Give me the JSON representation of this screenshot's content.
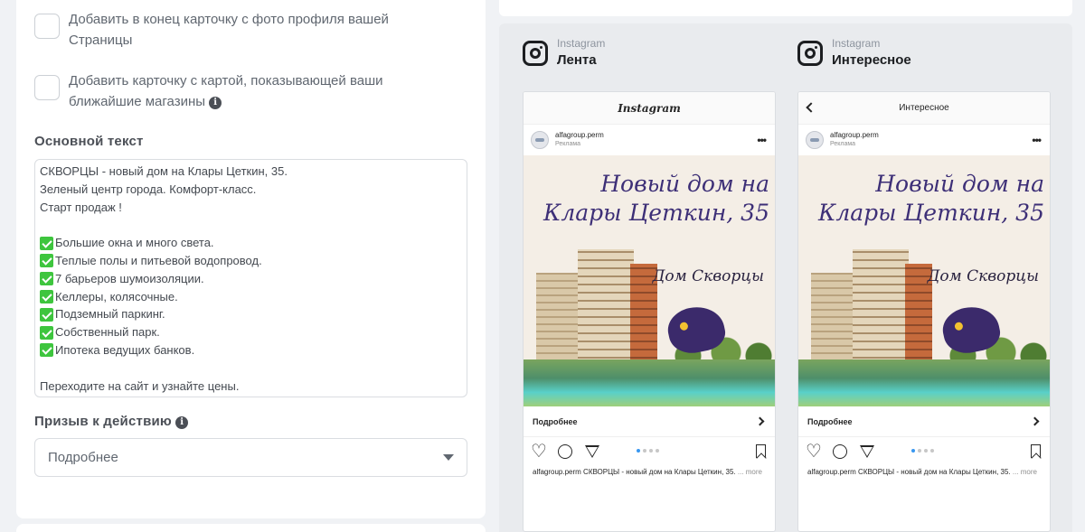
{
  "left": {
    "checkbox_profile_card": "Добавить в конец карточку с фото профиля вашей Страницы",
    "checkbox_map_card": "Добавить карточку с картой, показывающей ваши ближайшие магазины",
    "primary_text_label": "Основной текст",
    "primary_text_lines": [
      {
        "check": false,
        "text": "СКВОРЦЫ - новый дом на Клары Цеткин, 35."
      },
      {
        "check": false,
        "text": "Зеленый центр города. Комфорт-класс."
      },
      {
        "check": false,
        "text": "Старт продаж !"
      },
      {
        "check": false,
        "text": ""
      },
      {
        "check": true,
        "text": "Большие окна и много света."
      },
      {
        "check": true,
        "text": "Теплые полы и питьевой водопровод."
      },
      {
        "check": true,
        "text": "7 барьеров шумоизоляции."
      },
      {
        "check": true,
        "text": "Келлеры, колясочные."
      },
      {
        "check": true,
        "text": "Подземный паркинг."
      },
      {
        "check": true,
        "text": "Собственный парк."
      },
      {
        "check": true,
        "text": "Ипотека ведущих банков."
      },
      {
        "check": false,
        "text": ""
      },
      {
        "check": false,
        "text": "Переходите на сайт и узнайте цены."
      }
    ],
    "cta_label": "Призыв к действию",
    "cta_value": "Подробнее",
    "info_glyph": "i"
  },
  "previews": [
    {
      "platform": "Instagram",
      "placement": "Лента",
      "top_bar_title": "Instagram",
      "has_back": false,
      "account": "alfagroup.perm",
      "sponsored": "Реклама",
      "headline": "Новый дом на Клары Цеткин, 35",
      "brand": "Дом Скворцы",
      "cta": "Подробнее",
      "caption_account": "alfagroup.perm",
      "caption_text": "СКВОРЦЫ - новый дом на Клары Цеткин, 35.",
      "caption_more": "... more"
    },
    {
      "platform": "Instagram",
      "placement": "Интересное",
      "top_bar_title": "Интересное",
      "has_back": true,
      "account": "alfagroup.perm",
      "sponsored": "Реклама",
      "headline": "Новый дом на Клары Цеткин, 35",
      "brand": "Дом Скворцы",
      "cta": "Подробнее",
      "caption_account": "alfagroup.perm",
      "caption_text": "СКВОРЦЫ - новый дом на Клары Цеткин, 35.",
      "caption_more": "... more"
    }
  ],
  "icons": {
    "checkmark": "check-emoji-icon",
    "info": "info-icon",
    "dropdown": "caret-down-icon",
    "platform": "instagram-icon",
    "like": "heart-icon",
    "comment": "comment-icon",
    "share": "share-icon",
    "save": "bookmark-icon"
  },
  "colors": {
    "headline": "#3d2f77",
    "check_emoji": "#3ec53e",
    "pager_active": "#3897f0"
  }
}
